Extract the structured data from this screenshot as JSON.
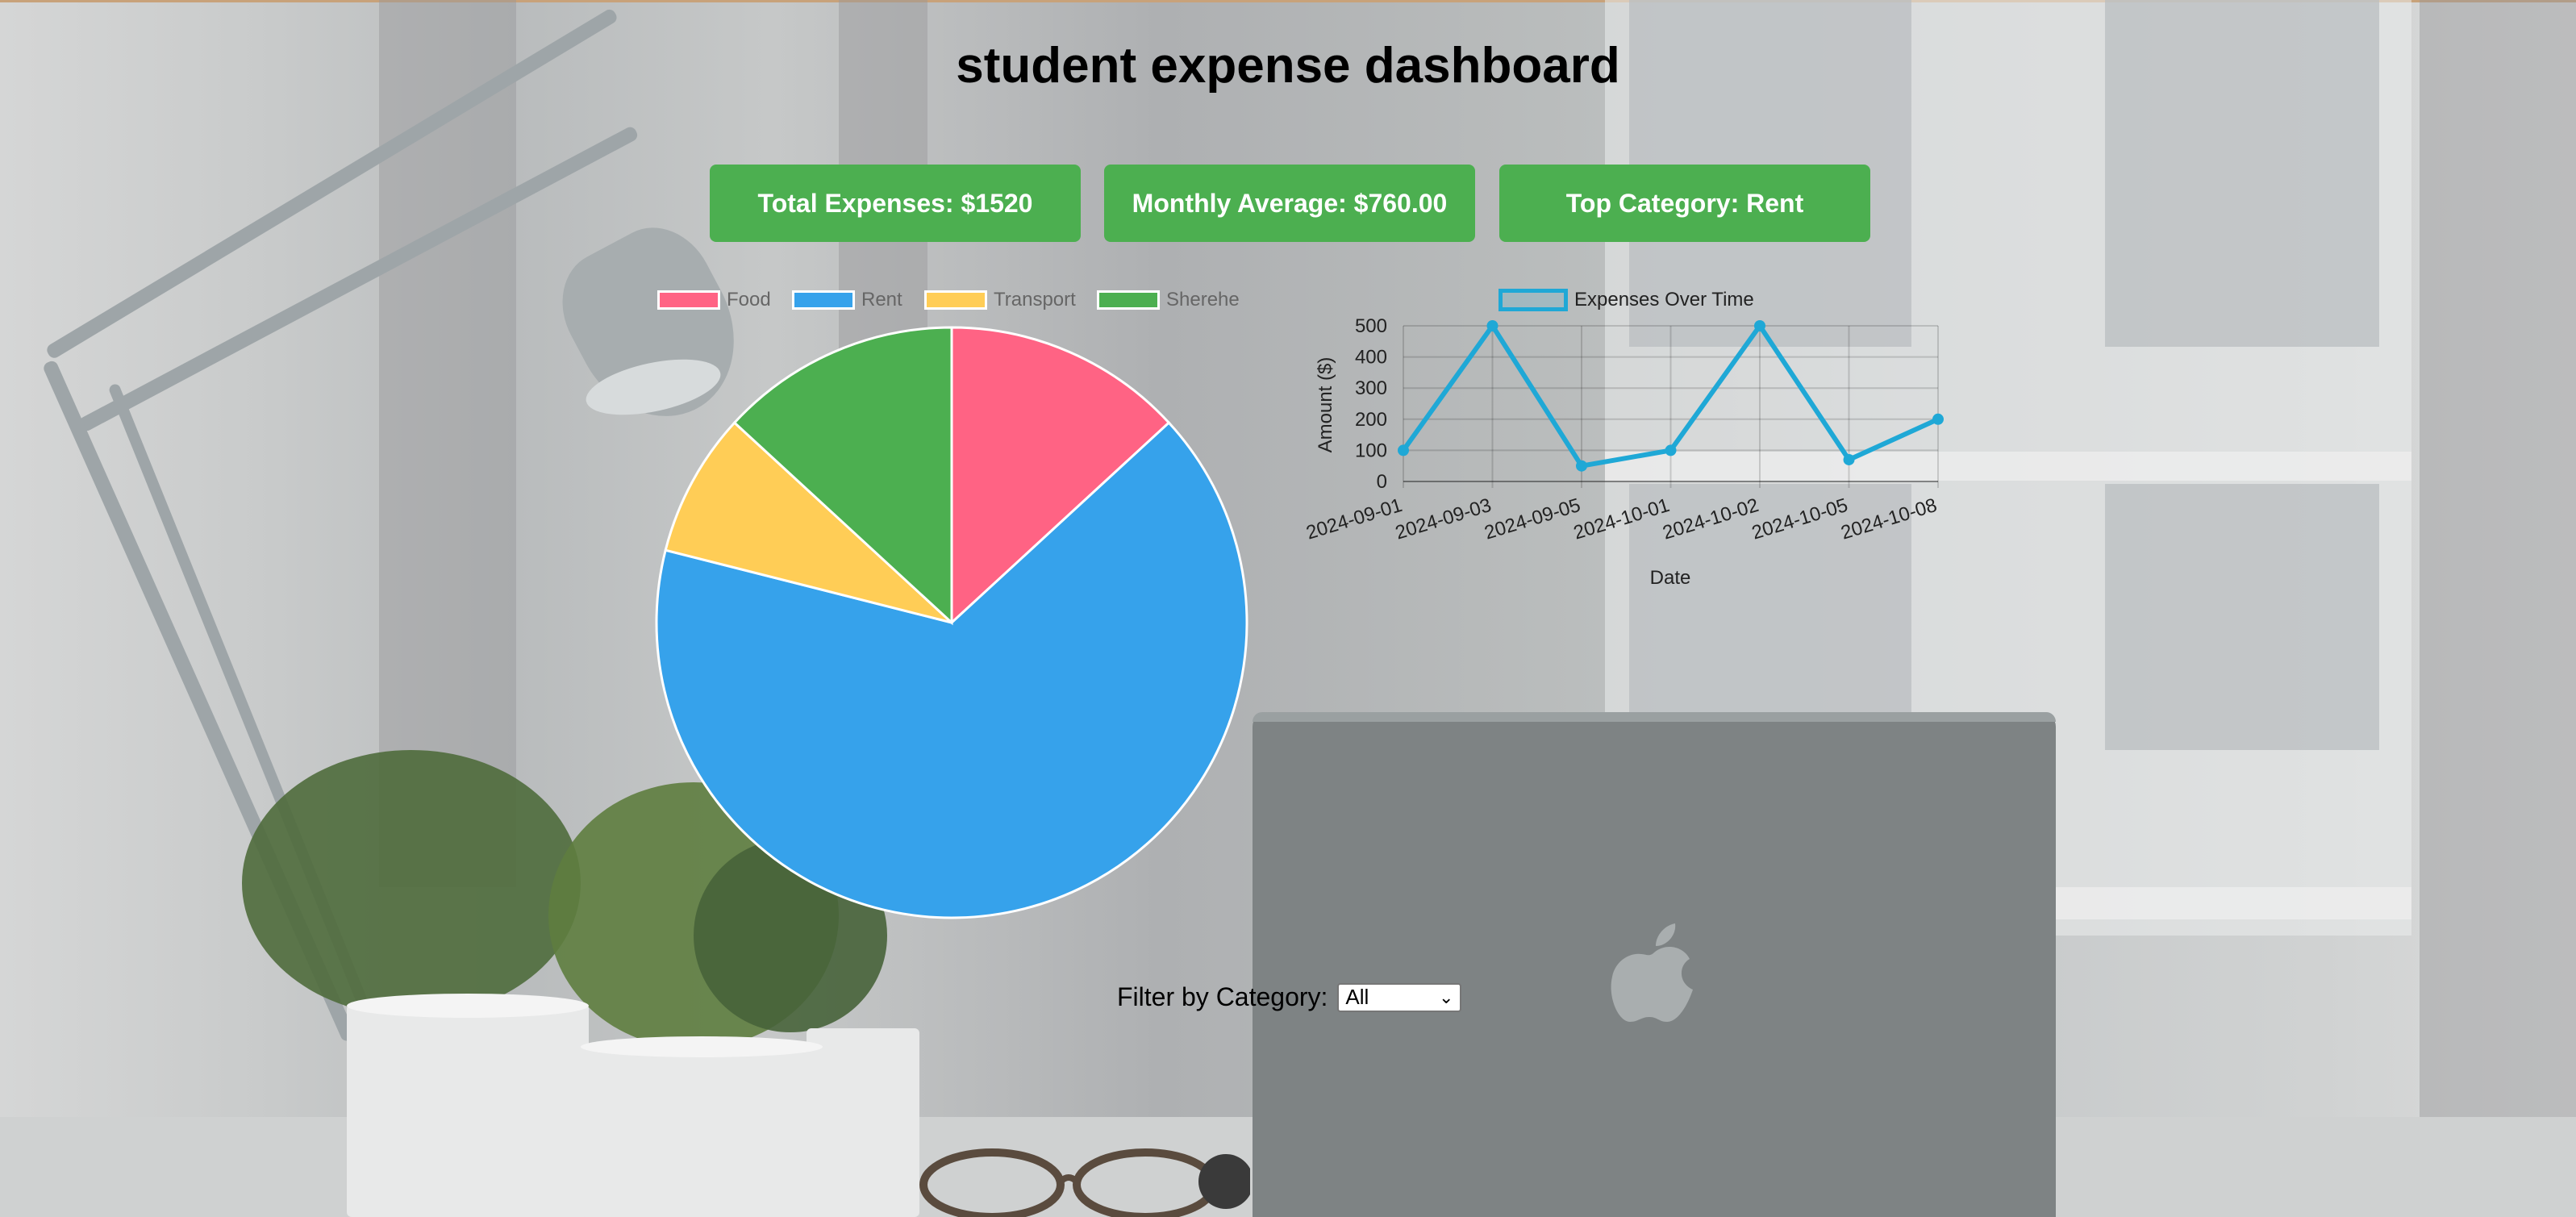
{
  "dashboard": {
    "title": "student expense dashboard",
    "cards": {
      "total": "Total Expenses: $1520",
      "average": "Monthly Average: $760.00",
      "top_category": "Top Category: Rent"
    },
    "filter": {
      "label": "Filter by Category:",
      "selected": "All"
    }
  },
  "colors": {
    "card_bg": "#4caf50",
    "food": "#ff6384",
    "rent": "#36a2eb",
    "transport": "#ffcd56",
    "other": "#4caf50",
    "line": "#1fa8d6"
  },
  "chart_data": [
    {
      "type": "pie",
      "legend_position": "top",
      "series": [
        {
          "name": "Food",
          "value": 200,
          "color": "#ff6384"
        },
        {
          "name": "Rent",
          "value": 1000,
          "color": "#36a2eb"
        },
        {
          "name": "Transport",
          "value": 120,
          "color": "#ffcd56"
        },
        {
          "name": "Sherehe",
          "value": 200,
          "color": "#4caf50"
        }
      ]
    },
    {
      "type": "line",
      "legend_position": "top",
      "series_name": "Expenses Over Time",
      "x": [
        "2024-09-01",
        "2024-09-03",
        "2024-09-05",
        "2024-10-01",
        "2024-10-02",
        "2024-10-05",
        "2024-10-08"
      ],
      "y": [
        100,
        500,
        50,
        100,
        500,
        70,
        200
      ],
      "xlabel": "Date",
      "ylabel": "Amount ($)",
      "ylim": [
        0,
        500
      ],
      "yticks": [
        0,
        100,
        200,
        300,
        400,
        500
      ],
      "grid": true
    }
  ]
}
